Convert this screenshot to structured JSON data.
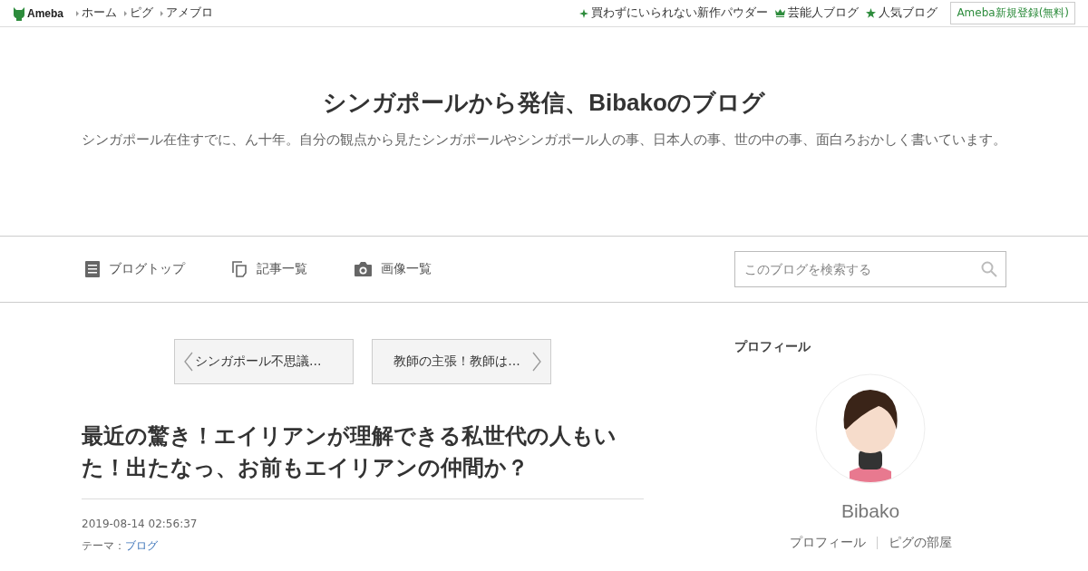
{
  "topbar": {
    "logo": "Ameba",
    "links": [
      "ホーム",
      "ピグ",
      "アメブロ"
    ],
    "right_links": [
      {
        "kind": "sparkle",
        "label": "買わずにいられない新作パウダー"
      },
      {
        "kind": "crown",
        "label": "芸能人ブログ"
      },
      {
        "kind": "star",
        "label": "人気ブログ"
      }
    ],
    "register_button": "Ameba新規登録(無料)"
  },
  "header": {
    "title": "シンガポールから発信、Bibakoのブログ",
    "description": "シンガポール在住すでに、ん十年。自分の観点から見たシンガポールやシンガポール人の事、日本人の事、世の中の事、面白ろおかしく書いています。"
  },
  "nav": {
    "items": [
      {
        "kind": "document",
        "label": "ブログトップ"
      },
      {
        "kind": "copies",
        "label": "記事一覧"
      },
      {
        "kind": "camera",
        "label": "画像一覧"
      }
    ],
    "search": {
      "placeholder": "このブログを検索する"
    }
  },
  "pager": {
    "previous": "シンガポール不思議…",
    "next": "教師の主張！教師は…"
  },
  "article": {
    "title": "最近の驚き！エイリアンが理解できる私世代の人もいた！出たなっ、お前もエイリアンの仲間か？",
    "date": "2019-08-14 02:56:37",
    "theme_label": "テーマ：",
    "theme": "ブログ"
  },
  "profile": {
    "heading": "プロフィール",
    "name": "Bibako",
    "links": [
      "プロフィール",
      "ピグの部屋"
    ]
  }
}
